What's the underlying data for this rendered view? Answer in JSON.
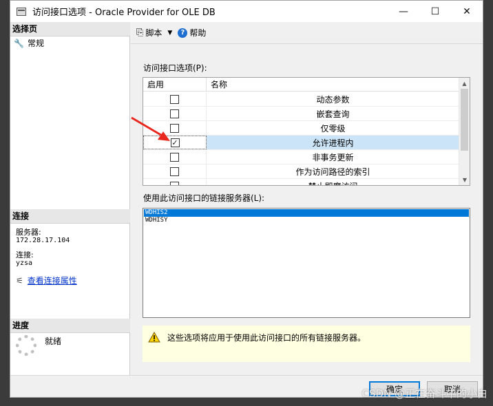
{
  "window": {
    "title": "访问接口选项 - Oracle Provider for OLE DB",
    "controls": [
      "—",
      "☐",
      "✕"
    ]
  },
  "left": {
    "select_page_header": "选择页",
    "pages": [
      {
        "label": "常规"
      }
    ],
    "connection_header": "连接",
    "server_label": "服务器:",
    "server_value": "172.28.17.104",
    "connection_label": "连接:",
    "connection_value": "yzsa",
    "view_conn_props": "查看连接属性",
    "progress_header": "进度",
    "progress_status": "就绪"
  },
  "toolbar": {
    "script_label": "脚本",
    "help_label": "帮助"
  },
  "options": {
    "group_label": "访问接口选项(P):",
    "col_enable": "启用",
    "col_name": "名称",
    "rows": [
      {
        "name": "动态参数",
        "checked": false
      },
      {
        "name": "嵌套查询",
        "checked": false
      },
      {
        "name": "仅零级",
        "checked": false
      },
      {
        "name": "允许进程内",
        "checked": true,
        "selected": true
      },
      {
        "name": "非事务更新",
        "checked": false
      },
      {
        "name": "作为访问路径的索引",
        "checked": false
      },
      {
        "name": "禁止即席访问",
        "checked": false
      }
    ]
  },
  "servers": {
    "group_label": "使用此访问接口的链接服务器(L):",
    "items": [
      {
        "name": "WDHIS2",
        "selected": true
      },
      {
        "name": "WDHISY",
        "selected": false
      }
    ]
  },
  "info": {
    "text": "这些选项将应用于使用此访问接口的所有链接服务器。"
  },
  "buttons": {
    "ok": "确定",
    "cancel": "取消"
  },
  "watermark": "CSDN @正在奋斗中的小白",
  "colors": {
    "accent": "#0078d7",
    "selected_row": "#cce4f7",
    "info_bg": "#ffffe1",
    "annotation_arrow": "#e8281f"
  }
}
